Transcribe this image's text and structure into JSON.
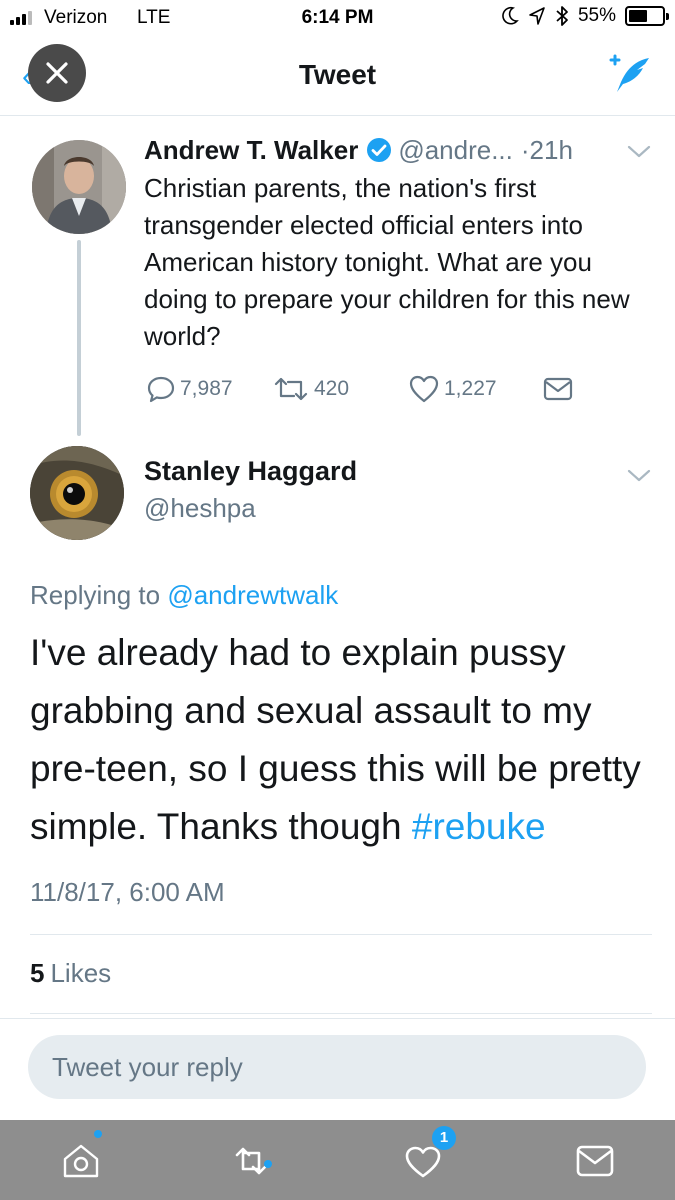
{
  "status_bar": {
    "carrier": "Verizon",
    "network": "LTE",
    "time": "6:14 PM",
    "battery": "55%",
    "battery_level": 0.55,
    "icons": [
      "moon-icon",
      "location-arrow-icon",
      "bluetooth-icon"
    ]
  },
  "nav": {
    "title": "Tweet",
    "close_icon": "close-icon",
    "back_icon": "chevron-left-icon",
    "compose_icon": "compose-tweet-icon"
  },
  "parent_tweet": {
    "name": "Andrew T. Walker",
    "verified": true,
    "handle": "@andre...",
    "dot": "·",
    "time": "21h",
    "text": "Christian parents, the nation's first transgender elected official enters into American history tonight. What are you doing to prepare your children for this new world?",
    "replies": "7,987",
    "retweets": "420",
    "likes": "1,227"
  },
  "reply_tweet": {
    "name": "Stanley Haggard",
    "handle": "@heshpa",
    "replying_prefix": "Replying to",
    "replying_mention": "@andrewtwalk",
    "text_main": "I've already had to explain pussy grabbing and sexual assault to my pre-teen, so I guess this will be pretty simple. Thanks though",
    "hashtag": "#rebuke",
    "timestamp": "11/8/17, 6:00 AM",
    "likes_count": "5",
    "likes_label": "Likes"
  },
  "reply_bar": {
    "placeholder": "Tweet your reply"
  },
  "tab_bar": {
    "items": [
      {
        "icon": "home-icon",
        "has_dot": true
      },
      {
        "icon": "retweet-icon",
        "has_dot": true
      },
      {
        "icon": "notifications-icon",
        "badge": "1"
      },
      {
        "icon": "messages-icon"
      }
    ]
  },
  "colors": {
    "accent": "#1da1f2",
    "text_primary": "#14171a",
    "text_secondary": "#657786",
    "divider": "#e1e8ed",
    "tab_bar_bg": "#8e8e8e"
  }
}
